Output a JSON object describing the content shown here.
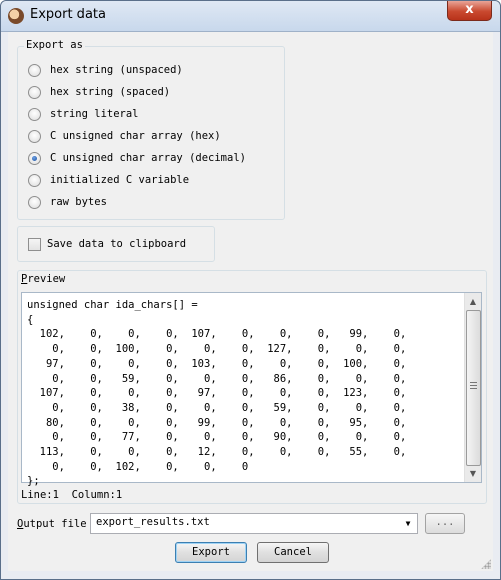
{
  "window": {
    "title": "Export data",
    "close_label": "x"
  },
  "export_as": {
    "legend": "Export as",
    "options": [
      {
        "label": "hex string (unspaced)",
        "checked": false
      },
      {
        "label": "hex string (spaced)",
        "checked": false
      },
      {
        "label": "string literal",
        "checked": false
      },
      {
        "label": "C unsigned char array (hex)",
        "checked": false
      },
      {
        "label": "C unsigned char array (decimal)",
        "checked": true
      },
      {
        "label": "initialized C variable",
        "checked": false
      },
      {
        "label": "raw bytes",
        "checked": false
      }
    ]
  },
  "clipboard": {
    "label": "Save data to clipboard",
    "checked": false
  },
  "preview": {
    "legend": "Preview",
    "lines": [
      "unsigned char ida_chars[] =",
      "{",
      "  102,    0,    0,    0,  107,    0,    0,    0,   99,    0,",
      "    0,    0,  100,    0,    0,    0,  127,    0,    0,    0,",
      "   97,    0,    0,    0,  103,    0,    0,    0,  100,    0,",
      "    0,    0,   59,    0,    0,    0,   86,    0,    0,    0,",
      "  107,    0,    0,    0,   97,    0,    0,    0,  123,    0,",
      "    0,    0,   38,    0,    0,    0,   59,    0,    0,    0,",
      "   80,    0,    0,    0,   99,    0,    0,    0,   95,    0,",
      "    0,    0,   77,    0,    0,    0,   90,    0,    0,    0,",
      "  113,    0,    0,    0,   12,    0,    0,    0,   55,    0,",
      "    0,    0,  102,    0,    0,    0",
      "};"
    ]
  },
  "status": {
    "line_label": "Line:",
    "line_value": "1",
    "column_label": "Column:",
    "column_value": "1"
  },
  "output_file": {
    "label": "Output file",
    "value": "export_results.txt",
    "browse_label": "..."
  },
  "buttons": {
    "export": "Export",
    "cancel": "Cancel"
  }
}
